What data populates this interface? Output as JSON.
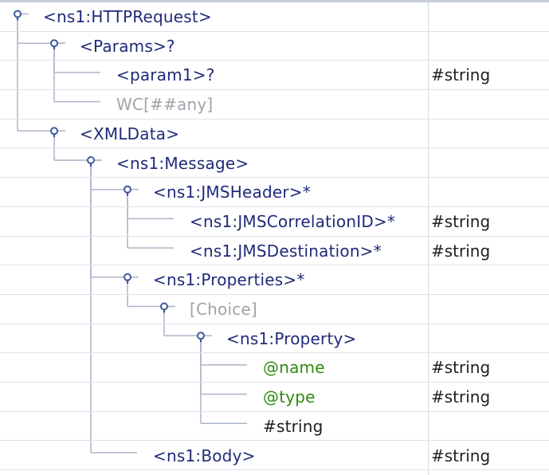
{
  "tree": {
    "rows": [
      {
        "label": "<ns1:HTTPRequest>",
        "type": "",
        "depth": 0,
        "kind": "element",
        "expanded": true
      },
      {
        "label": "<Params>?",
        "type": "",
        "depth": 1,
        "kind": "element",
        "expanded": true
      },
      {
        "label": "<param1>?",
        "type": "#string",
        "depth": 2,
        "kind": "element",
        "expanded": false
      },
      {
        "label": "WC[##any]",
        "type": "",
        "depth": 2,
        "kind": "gray",
        "expanded": false
      },
      {
        "label": "<XMLData>",
        "type": "",
        "depth": 1,
        "kind": "element",
        "expanded": true
      },
      {
        "label": "<ns1:Message>",
        "type": "",
        "depth": 2,
        "kind": "element",
        "expanded": true
      },
      {
        "label": "<ns1:JMSHeader>*",
        "type": "",
        "depth": 3,
        "kind": "element",
        "expanded": true
      },
      {
        "label": "<ns1:JMSCorrelationID>*",
        "type": "#string",
        "depth": 4,
        "kind": "element",
        "expanded": false
      },
      {
        "label": "<ns1:JMSDestination>*",
        "type": "#string",
        "depth": 4,
        "kind": "element",
        "expanded": false
      },
      {
        "label": "<ns1:Properties>*",
        "type": "",
        "depth": 3,
        "kind": "element",
        "expanded": true
      },
      {
        "label": "[Choice]",
        "type": "",
        "depth": 4,
        "kind": "gray",
        "expanded": true
      },
      {
        "label": "<ns1:Property>",
        "type": "",
        "depth": 5,
        "kind": "element",
        "expanded": true
      },
      {
        "label": "@name",
        "type": "#string",
        "depth": 6,
        "kind": "attr",
        "expanded": false
      },
      {
        "label": "@type",
        "type": "#string",
        "depth": 6,
        "kind": "attr",
        "expanded": false
      },
      {
        "label": "#string",
        "type": "",
        "depth": 6,
        "kind": "text",
        "expanded": false
      },
      {
        "label": "<ns1:Body>",
        "type": "#string",
        "depth": 3,
        "kind": "element",
        "expanded": false
      }
    ]
  },
  "colors": {
    "element": "#1f2a7a",
    "attribute": "#2e8b10",
    "gray": "#9ea4ab",
    "guide": "#a9b4c8",
    "toggle": "#3b5a9a"
  }
}
